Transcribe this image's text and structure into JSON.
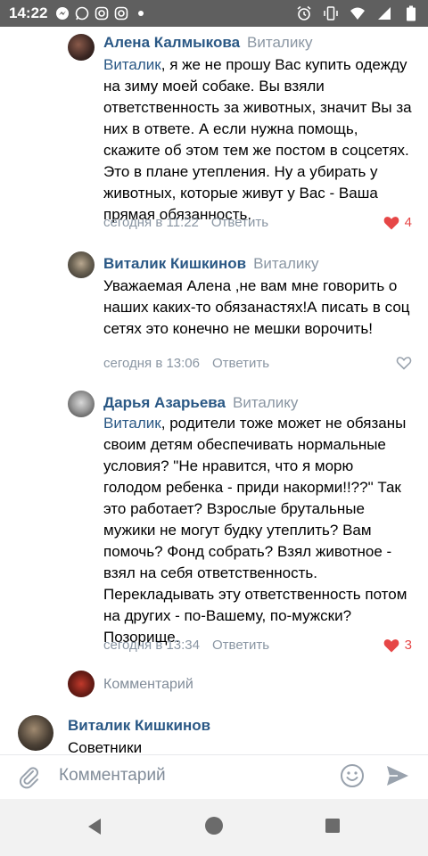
{
  "status_bar": {
    "time": "14:22",
    "left_icons": [
      "messenger-icon",
      "whatsapp-icon",
      "instagram-icon",
      "instagram-icon",
      "notification-dot-icon"
    ],
    "right_icons": [
      "alarm-icon",
      "vibrate-icon",
      "wifi-icon",
      "signal-icon",
      "battery-icon"
    ]
  },
  "comments": [
    {
      "author": "Алена Калмыкова",
      "reply_to": "Виталику",
      "mention": "Виталик",
      "text": ", я же не прошу Вас купить одежду на зиму моей собаке. Вы взяли ответственность за животных, значит Вы за них в ответе. А если нужна помощь, скажите об этом тем же постом в соцсетях. Это в плане утепления. Ну а убирать у животных, которые живут у Вас - Ваша прямая обязанность.",
      "time": "сегодня в 11:22",
      "reply_label": "Ответить",
      "likes": "4",
      "liked": true
    },
    {
      "author": "Виталик Кишкинов",
      "reply_to": "Виталику",
      "mention": "",
      "text": "Уважаемая Алена ,не вам мне говорить о наших каких-то обязанастях!А писать в соц сетях это конечно не мешки ворочить!",
      "time": "сегодня в 13:06",
      "reply_label": "Ответить",
      "likes": "",
      "liked": false
    },
    {
      "author": "Дарья Азарьева",
      "reply_to": "Виталику",
      "mention": "Виталик",
      "text": ", родители тоже может не обязаны своим детям обеспечивать нормальные условия? \"Не нравится, что я морю голодом ребенка - приди накорми!!??\" Так это работает? Взрослые брутальные мужики не могут будку утеплить? Вам помочь? Фонд собрать? Взял животное - взял на себя ответственность. Перекладывать эту ответственность потом на других - по-Вашему, по-мужски? Позорище.",
      "time": "сегодня в 13:34",
      "reply_label": "Ответить",
      "likes": "3",
      "liked": true
    }
  ],
  "reply_prompt": "Комментарий",
  "next_comment": {
    "author": "Виталик Кишкинов",
    "text": "Советники"
  },
  "input": {
    "placeholder": "Комментарий"
  },
  "colors": {
    "link": "#2a5885",
    "meta": "#8a96a3",
    "like": "#e64646",
    "status_bar": "#5f5f5f"
  }
}
